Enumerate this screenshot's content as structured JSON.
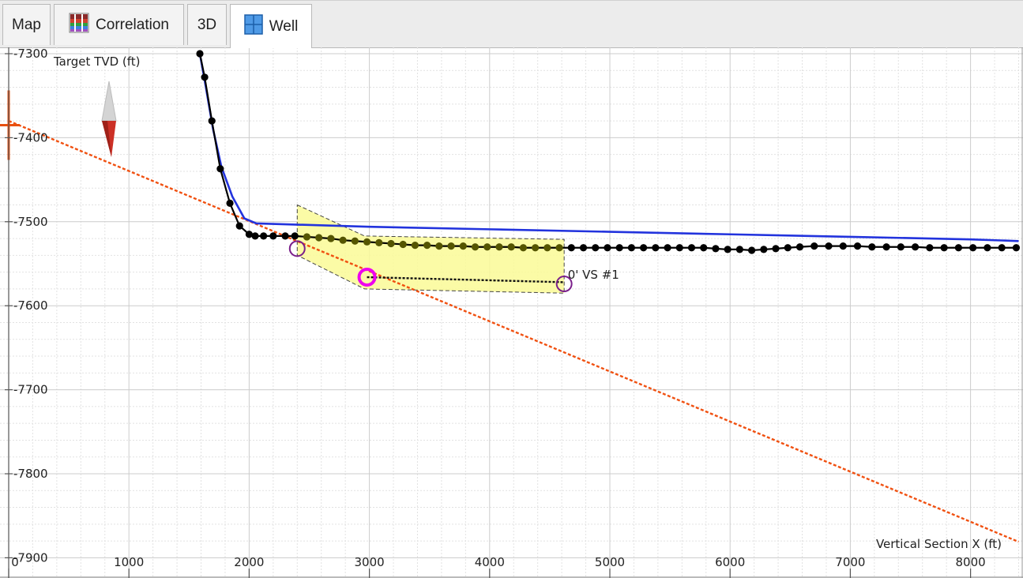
{
  "tabs": [
    {
      "label": "Map",
      "icon": "none",
      "active": false
    },
    {
      "label": "Correlation",
      "icon": "correlation-icon",
      "active": false
    },
    {
      "label": "3D",
      "icon": "none",
      "active": false
    },
    {
      "label": "Well",
      "icon": "grid-icon",
      "active": true
    }
  ],
  "chart_data": {
    "type": "line",
    "ylabel": "Target TVD (ft)",
    "xlabel": "Vertical Section X (ft)",
    "xlim": [
      0,
      8400
    ],
    "ylim": [
      7300,
      7900
    ],
    "xticks": [
      0,
      1000,
      2000,
      3000,
      4000,
      5000,
      6000,
      7000,
      8000
    ],
    "yticks": [
      7300,
      7400,
      7500,
      7600,
      7700,
      7800,
      7900
    ],
    "grid": true,
    "colors": {
      "plan": "#2233dd",
      "survey": "#000000",
      "survey_in_zone": "#555500",
      "projection": "#f05010",
      "target_zone": "#fafa96",
      "circle": "#7a1f8a",
      "highlight_circle": "#ee00ee",
      "marker": "#e85010",
      "compass_top": "#cfcfcf",
      "compass_bottom": "#d03025"
    },
    "series": [
      {
        "role": "plan",
        "points": [
          [
            1590,
            7300
          ],
          [
            1640,
            7340
          ],
          [
            1700,
            7390
          ],
          [
            1770,
            7435
          ],
          [
            1860,
            7470
          ],
          [
            1960,
            7496
          ],
          [
            2060,
            7502
          ],
          [
            3000,
            7506
          ],
          [
            4000,
            7509
          ],
          [
            5000,
            7512
          ],
          [
            6000,
            7515
          ],
          [
            7000,
            7518
          ],
          [
            8000,
            7521
          ],
          [
            8400,
            7523
          ]
        ]
      },
      {
        "role": "survey",
        "points": [
          [
            1590,
            7300
          ],
          [
            1630,
            7328
          ],
          [
            1690,
            7380
          ],
          [
            1760,
            7437
          ],
          [
            1840,
            7478
          ],
          [
            1920,
            7505
          ],
          [
            2000,
            7515
          ],
          [
            2050,
            7517
          ],
          [
            2120,
            7517
          ],
          [
            2200,
            7517
          ],
          [
            2300,
            7517
          ],
          [
            2380,
            7517
          ],
          [
            2480,
            7518
          ],
          [
            2580,
            7519
          ],
          [
            2680,
            7520
          ],
          [
            2780,
            7522
          ],
          [
            2880,
            7523
          ],
          [
            2980,
            7524
          ],
          [
            3080,
            7525
          ],
          [
            3180,
            7526
          ],
          [
            3280,
            7527
          ],
          [
            3380,
            7528
          ],
          [
            3480,
            7528
          ],
          [
            3580,
            7529
          ],
          [
            3680,
            7529
          ],
          [
            3780,
            7529
          ],
          [
            3880,
            7530
          ],
          [
            3980,
            7530
          ],
          [
            4080,
            7530
          ],
          [
            4180,
            7530
          ],
          [
            4280,
            7531
          ],
          [
            4380,
            7531
          ],
          [
            4480,
            7531
          ],
          [
            4580,
            7531
          ],
          [
            4680,
            7531
          ],
          [
            4780,
            7531
          ],
          [
            4880,
            7531
          ],
          [
            4980,
            7531
          ],
          [
            5080,
            7531
          ],
          [
            5180,
            7531
          ],
          [
            5280,
            7531
          ],
          [
            5380,
            7531
          ],
          [
            5480,
            7531
          ],
          [
            5580,
            7531
          ],
          [
            5680,
            7531
          ],
          [
            5780,
            7531
          ],
          [
            5880,
            7532
          ],
          [
            5980,
            7533
          ],
          [
            6080,
            7533
          ],
          [
            6180,
            7534
          ],
          [
            6280,
            7533
          ],
          [
            6380,
            7532
          ],
          [
            6480,
            7531
          ],
          [
            6580,
            7530
          ],
          [
            6700,
            7529
          ],
          [
            6820,
            7529
          ],
          [
            6940,
            7529
          ],
          [
            7060,
            7529
          ],
          [
            7180,
            7530
          ],
          [
            7300,
            7530
          ],
          [
            7420,
            7530
          ],
          [
            7540,
            7530
          ],
          [
            7660,
            7531
          ],
          [
            7780,
            7531
          ],
          [
            7900,
            7531
          ],
          [
            8020,
            7531
          ],
          [
            8140,
            7531
          ],
          [
            8260,
            7531
          ],
          [
            8380,
            7531
          ]
        ]
      },
      {
        "role": "projection",
        "points": [
          [
            0,
            7380
          ],
          [
            8400,
            7881
          ]
        ]
      }
    ],
    "target_zone": {
      "polygon": [
        [
          2400,
          7480
        ],
        [
          2960,
          7517
        ],
        [
          4620,
          7521
        ],
        [
          4620,
          7585
        ],
        [
          2960,
          7580
        ],
        [
          2400,
          7540
        ]
      ]
    },
    "projection_segment": [
      [
        2980,
        7566
      ],
      [
        4620,
        7572
      ]
    ],
    "circles": [
      {
        "role": "target-start",
        "x": 2400,
        "y": 7532
      },
      {
        "role": "highlight",
        "x": 2980,
        "y": 7566
      },
      {
        "role": "target-end",
        "x": 4620,
        "y": 7574
      }
    ],
    "zone_dots_x_range": [
      2400,
      4620
    ],
    "tie_in_marker": {
      "x": 0,
      "y": 7385
    },
    "annotations": [
      {
        "text": "0' VS #1",
        "x": 4650,
        "y": 7563
      }
    ]
  }
}
